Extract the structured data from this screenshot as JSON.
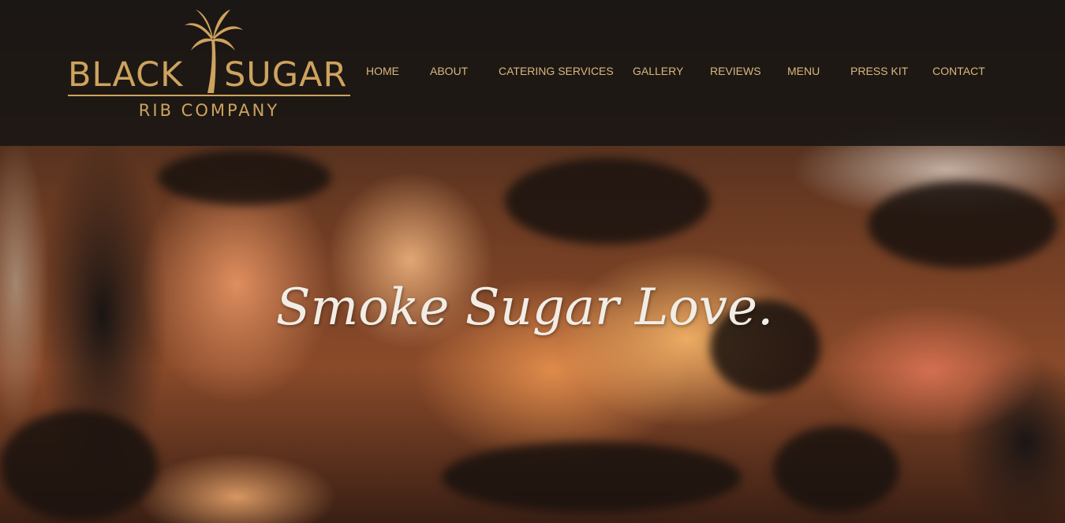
{
  "brand": {
    "word1": "BLACK",
    "word2": "SUGAR",
    "subtitle": "RIB COMPANY",
    "palm_icon": "palm-tree-icon",
    "color": "#cda35e"
  },
  "nav": {
    "items": [
      {
        "label": "HOME"
      },
      {
        "label": "ABOUT"
      },
      {
        "label": "CATERING SERVICES"
      },
      {
        "label": "GALLERY"
      },
      {
        "label": "REVIEWS"
      },
      {
        "label": "MENU"
      },
      {
        "label": "PRESS KIT"
      },
      {
        "label": "CONTACT"
      }
    ],
    "color": "#d9b77e"
  },
  "hero": {
    "tagline": "Smoke Sugar Love."
  }
}
